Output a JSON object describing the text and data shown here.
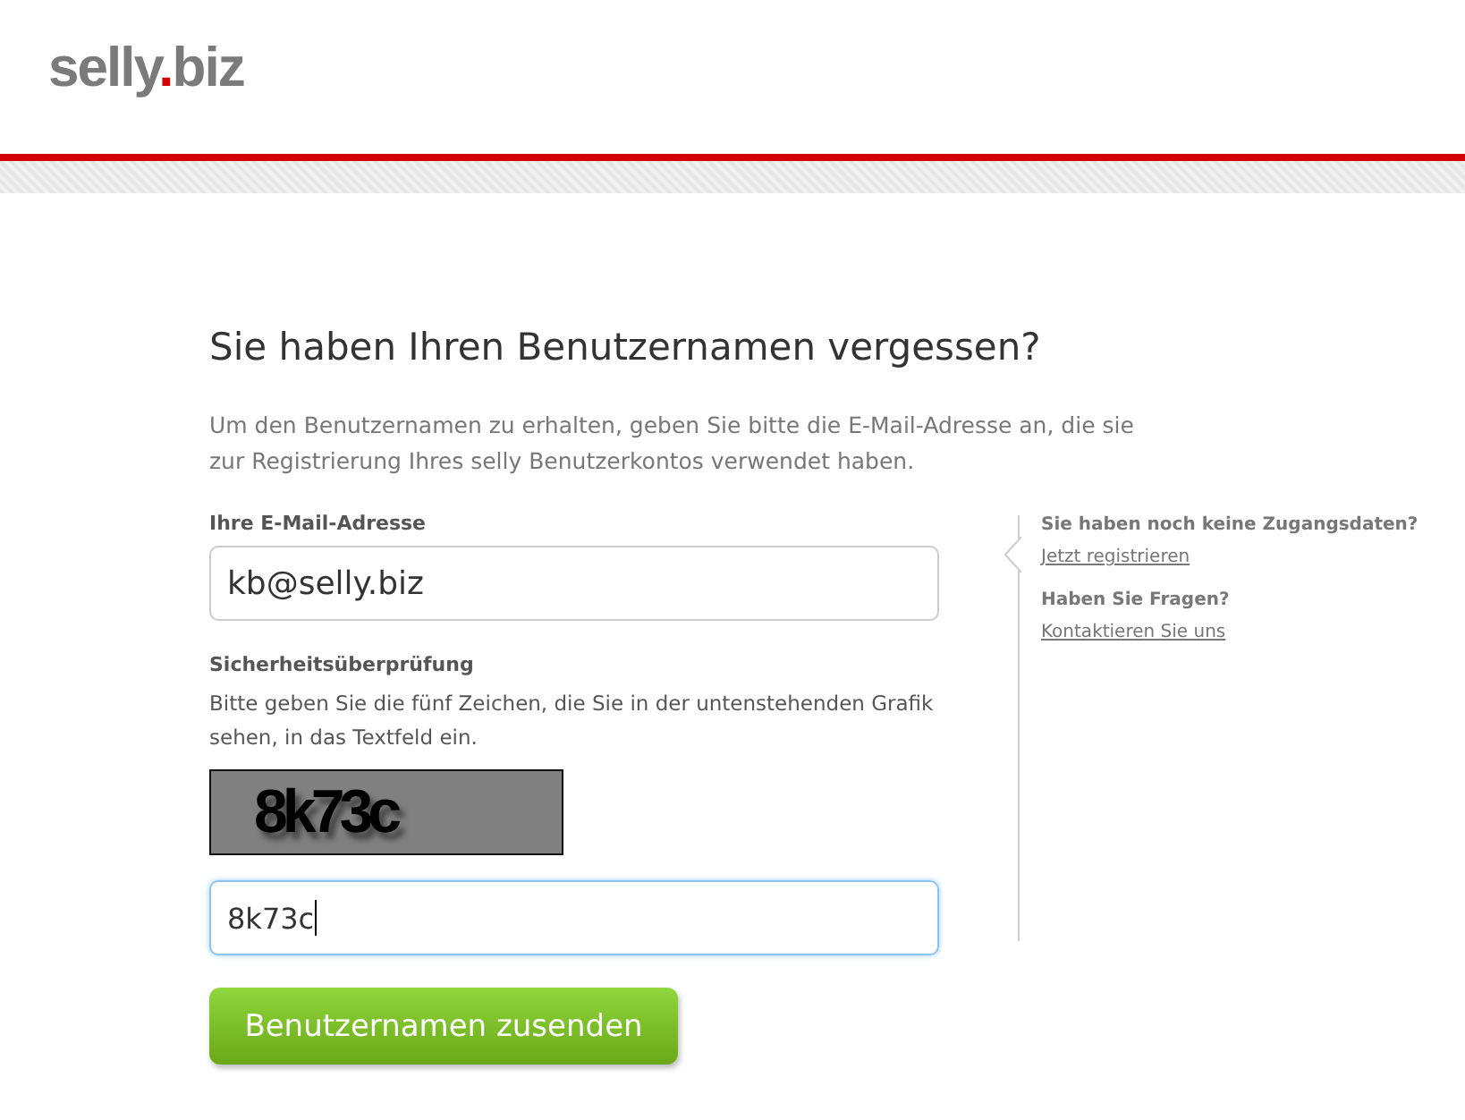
{
  "logo": {
    "parts": [
      {
        "text": "selly",
        "color": "#7b7b7b"
      },
      {
        "text": ".",
        "color": "#d60000"
      },
      {
        "text": "biz",
        "color": "#7b7b7b"
      }
    ]
  },
  "title": "Sie haben Ihren Benutzernamen vergessen?",
  "intro": "Um den Benutzernamen zu erhalten, geben Sie bitte die E-Mail-Adresse an, die sie zur Registrierung Ihres selly Benutzerkontos verwendet haben.",
  "email": {
    "label": "Ihre E-Mail-Adresse",
    "value": "kb@selly.biz",
    "focused": false
  },
  "security": {
    "label": "Sicherheitsüberprüfung",
    "hint": "Bitte geben Sie die fünf Zeichen, die Sie in der untenstehenden Grafik sehen, in das Textfeld ein.",
    "captcha": "8k73c",
    "value": "8k73c",
    "focused": true
  },
  "submit": "Benutzernamen zusenden",
  "sidebar": [
    {
      "question": "Sie haben noch keine Zugangsdaten?",
      "link": "Jetzt registrieren"
    },
    {
      "question": "Haben Sie Fragen?",
      "link": "Kontaktieren Sie uns"
    }
  ]
}
